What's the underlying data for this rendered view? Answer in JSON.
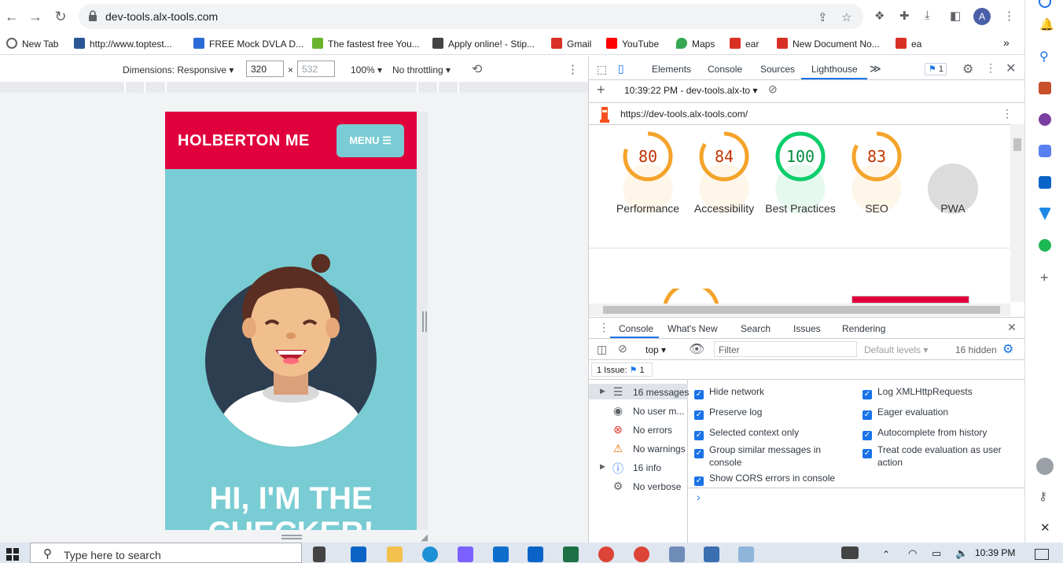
{
  "browser": {
    "url": "dev-tools.alx-tools.com",
    "avatar_letter": "A",
    "bookmarks": [
      {
        "label": "New Tab",
        "color": "#5f6368"
      },
      {
        "label": "http://www.toptest...",
        "color": "#2b5797"
      },
      {
        "label": "FREE Mock DVLA D...",
        "color": "#2a6bd6"
      },
      {
        "label": "The fastest free You...",
        "color": "#6ab42d"
      },
      {
        "label": "Apply online! - Stip...",
        "color": "#444444"
      },
      {
        "label": "Gmail",
        "color": "#d93025"
      },
      {
        "label": "YouTube",
        "color": "#ff0000"
      },
      {
        "label": "Maps",
        "color": "#34a853"
      },
      {
        "label": "ear",
        "color": "#d93025"
      },
      {
        "label": "New Document No...",
        "color": "#d93025"
      },
      {
        "label": "ea",
        "color": "#d93025"
      }
    ],
    "bookmarks_more": "»"
  },
  "device_toolbar": {
    "dimensions_label": "Dimensions: Responsive ▾",
    "width": "320",
    "times": "×",
    "height_placeholder": "532",
    "zoom": "100% ▾",
    "throttling": "No throttling ▾"
  },
  "emulated_page": {
    "brand": "HOLBERTON ME",
    "menu_label": "MENU ☰",
    "hero_title": "HI, I'M THE CHECKER!",
    "colors": {
      "header": "#e0003c",
      "body": "#79ccd3",
      "avatar_bg": "#2d3e50"
    }
  },
  "devtools": {
    "tabs": [
      "Elements",
      "Console",
      "Sources",
      "Lighthouse"
    ],
    "active_tab": "Lighthouse",
    "more_tabs": "≫",
    "issues_badge": "1",
    "report_selector": "10:39:22 PM - dev-tools.alx-to ▾",
    "report_url": "https://dev-tools.alx-tools.com/",
    "scores": [
      {
        "value": "80",
        "label": "Performance",
        "color": "#f4a32b",
        "score": 0.8
      },
      {
        "value": "84",
        "label": "Accessibility",
        "color": "#f4a32b",
        "score": 0.84
      },
      {
        "value": "100",
        "label": "Best Practices",
        "color": "#0cce6b",
        "score": 1.0
      },
      {
        "value": "83",
        "label": "SEO",
        "color": "#f4a32b",
        "score": 0.83
      },
      {
        "value": "PWA",
        "label": "PWA",
        "color": "#bdbdbd",
        "score": 0
      }
    ],
    "drawer_tabs": [
      "Console",
      "What's New",
      "Search",
      "Issues",
      "Rendering"
    ],
    "drawer_active": "Console",
    "context": "top ▾",
    "filter_placeholder": "Filter",
    "levels": "Default levels ▾",
    "hidden": "16 hidden",
    "issue_label": "1 Issue:",
    "issue_count": "1",
    "sidebar": [
      {
        "label": "16 messages",
        "icon": "☰",
        "expand": "▶"
      },
      {
        "label": "No user m...",
        "icon": "◉",
        "expand": ""
      },
      {
        "label": "No errors",
        "icon": "⊗",
        "expand": ""
      },
      {
        "label": "No warnings",
        "icon": "⚠",
        "expand": ""
      },
      {
        "label": "16 info",
        "icon": "ⓘ",
        "expand": "▶"
      },
      {
        "label": "No verbose",
        "icon": "⚙",
        "expand": ""
      }
    ],
    "settings_left": [
      "Hide network",
      "Preserve log",
      "Selected context only",
      "Group similar messages in console",
      "Show CORS errors in console"
    ],
    "settings_right": [
      "Log XMLHttpRequests",
      "Eager evaluation",
      "Autocomplete from history",
      "Treat code evaluation as user action"
    ],
    "prompt": "›"
  },
  "taskbar": {
    "search_placeholder": "Type here to search",
    "time": "10:39 PM"
  }
}
